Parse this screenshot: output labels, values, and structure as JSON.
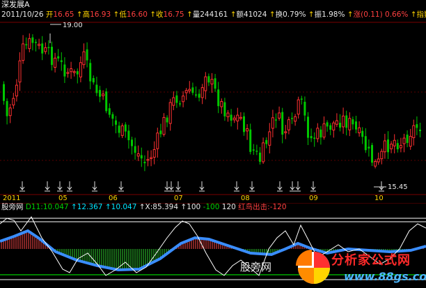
{
  "stock": {
    "name": "深发展A"
  },
  "quote": {
    "date": "2011/10/26",
    "open_label": "开",
    "open": "16.65",
    "high_label": "高",
    "high": "16.93",
    "low_label": "低",
    "low": "16.60",
    "close_label": "收",
    "close": "16.75",
    "vol_label": "量",
    "vol": "244161",
    "amt_label": "额",
    "amt": "41024",
    "turn_label": "换",
    "turn": "0.79%",
    "amp_label": "振",
    "amp": "1.98%",
    "chg_label": "涨",
    "chg": "(0.11)",
    "chgpct": "0.66%",
    "idx_label": "指数"
  },
  "price_marks": {
    "max": "19.00",
    "min": "15.45"
  },
  "dates": [
    "2011",
    "05",
    "06",
    "07",
    "08",
    "09",
    "10"
  ],
  "indicator": {
    "name": "股旁网",
    "d11_label": "D11:",
    "d11": "10.047",
    "v2": "12.367",
    "v3": "10.047",
    "x_label": "X:",
    "x": "85.394",
    "v5": "100",
    "v6": "-100",
    "v7": "120",
    "signal": "红鸟出击:-120"
  },
  "watermark": {
    "text": "股旁网"
  },
  "logo": {
    "brand": "分析家公式网",
    "url": "www.88gs.com"
  },
  "colors": {
    "up": "#ff3030",
    "down": "#00c800",
    "ma": "#3a8dff",
    "bg": "#000000",
    "grid": "#7a0000"
  }
}
